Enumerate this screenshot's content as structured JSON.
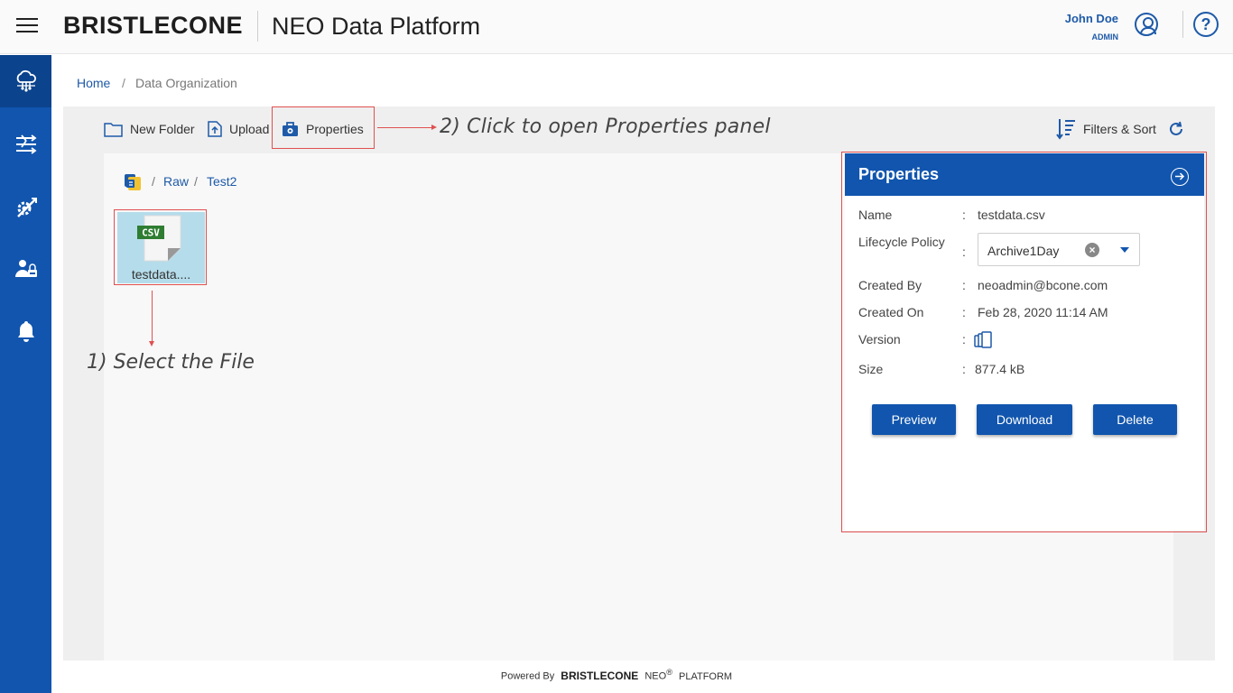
{
  "header": {
    "menu_icon": "hamburger-menu-icon",
    "brand": "BRISTLECONE",
    "app_title": "NEO Data Platform",
    "user_name": "John Doe",
    "user_role": "ADMIN",
    "user_icon": "user-circle-icon",
    "help_icon": "?"
  },
  "sidebar": {
    "items": [
      {
        "icon": "cloud-network-icon",
        "active": true
      },
      {
        "icon": "pipelines-icon",
        "active": false
      },
      {
        "icon": "tools-icon",
        "active": false
      },
      {
        "icon": "user-access-icon",
        "active": false
      },
      {
        "icon": "bell-icon",
        "active": false
      }
    ]
  },
  "breadcrumb": {
    "home": "Home",
    "separator": "/",
    "current": "Data Organization"
  },
  "toolbar": {
    "new_folder": "New Folder",
    "upload": "Upload",
    "properties": "Properties",
    "filters_sort": "Filters & Sort"
  },
  "annotations": {
    "step2": "2) Click to open Properties panel",
    "step1": "1) Select the File"
  },
  "path": {
    "sep": "/",
    "segments": [
      "Raw",
      "Test2"
    ]
  },
  "file": {
    "badge": "CSV",
    "name": "testdata...."
  },
  "properties": {
    "title": "Properties",
    "colon": ":",
    "name_label": "Name",
    "name_value": "testdata.csv",
    "lifecycle_label": "Lifecycle Policy",
    "lifecycle_value": "Archive1Day",
    "created_by_label": "Created By",
    "created_by_value": "neoadmin@bcone.com",
    "created_on_label": "Created On",
    "created_on_value": "Feb 28, 2020 11:14 AM",
    "version_label": "Version",
    "size_label": "Size",
    "size_value": "877.4 kB",
    "preview": "Preview",
    "download": "Download",
    "delete": "Delete"
  },
  "footer": {
    "powered_by": "Powered By",
    "brand": "BRISTLECONE",
    "neo": "NEO",
    "reg": "®",
    "platform": "PLATFORM"
  },
  "colors": {
    "primary": "#1155ae",
    "link": "#1e5aa8",
    "annotation": "#e05050",
    "tile": "#b5dcea"
  }
}
